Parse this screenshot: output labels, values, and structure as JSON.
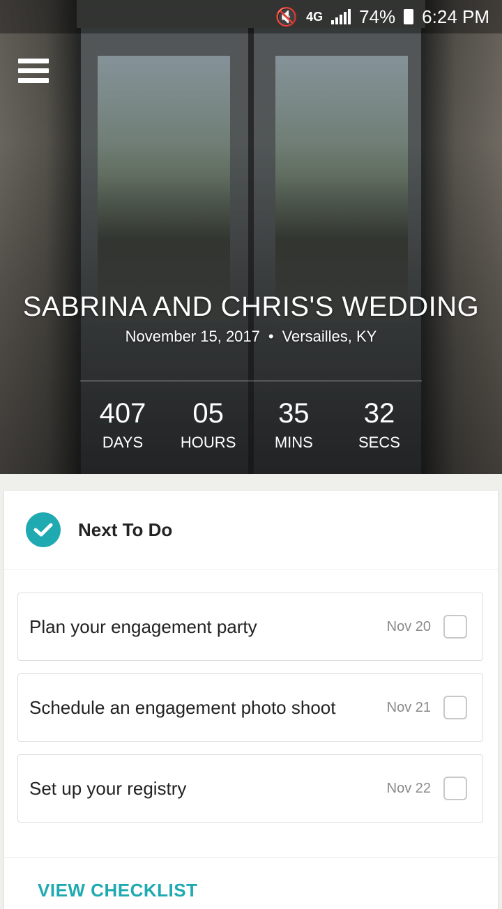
{
  "status_bar": {
    "network": "4G",
    "battery": "74%",
    "time": "6:24 PM"
  },
  "hero": {
    "title": "SABRINA AND CHRIS'S WEDDING",
    "date": "November 15, 2017",
    "separator": "•",
    "location": "Versailles, KY",
    "countdown": [
      {
        "value": "407",
        "label": "DAYS"
      },
      {
        "value": "05",
        "label": "HOURS"
      },
      {
        "value": "35",
        "label": "MINS"
      },
      {
        "value": "32",
        "label": "SECS"
      }
    ]
  },
  "todo": {
    "title": "Next To Do",
    "tasks": [
      {
        "label": "Plan your engagement party",
        "date": "Nov 20"
      },
      {
        "label": "Schedule an engagement photo shoot",
        "date": "Nov 21"
      },
      {
        "label": "Set up your registry",
        "date": "Nov 22"
      }
    ],
    "view_link": "VIEW CHECKLIST"
  },
  "colors": {
    "accent": "#1fa9b0"
  }
}
